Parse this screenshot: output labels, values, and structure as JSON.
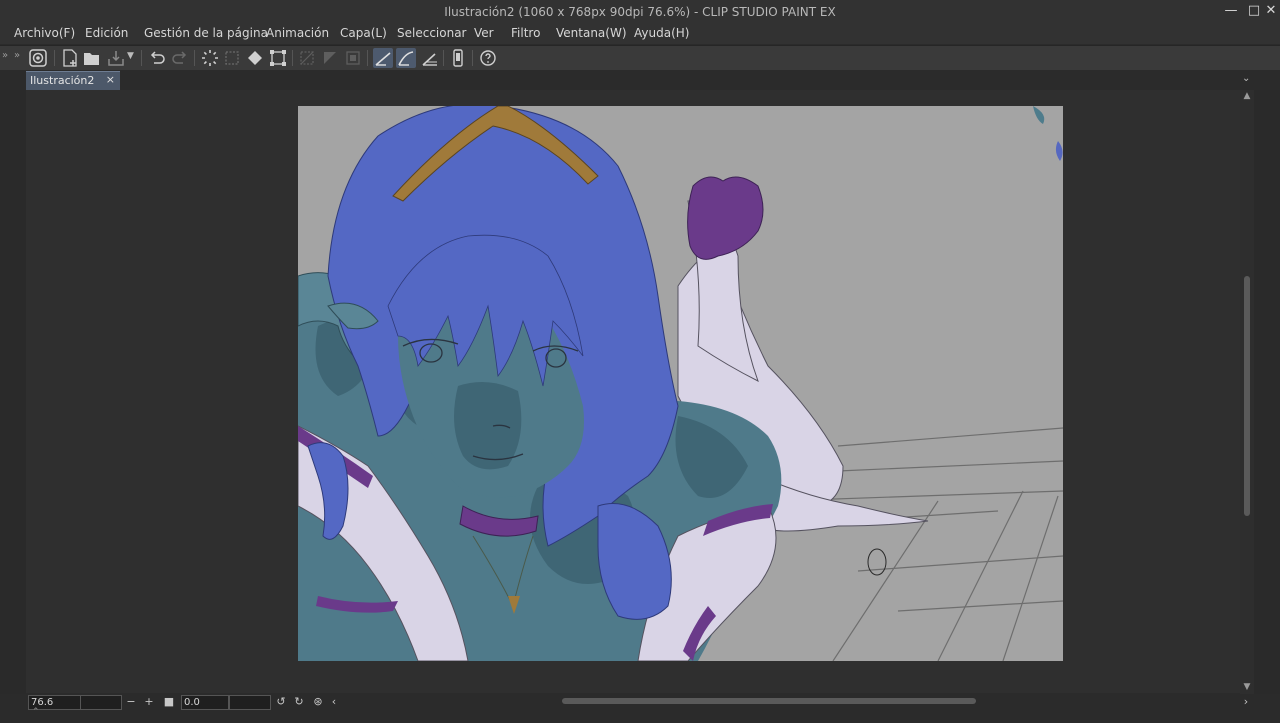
{
  "window": {
    "title": "Ilustración2 (1060 x 768px 90dpi 76.6%)  - CLIP STUDIO PAINT EX",
    "minimize_icon": "minimize-icon",
    "maximize_icon": "maximize-icon",
    "close_icon": "close-icon"
  },
  "menu": {
    "items": [
      "Archivo(F)",
      "Edición",
      "Gestión de la página",
      "Animación",
      "Capa(L)",
      "Seleccionar",
      "Ver",
      "Filtro",
      "Ventana(W)",
      "Ayuda(H)"
    ]
  },
  "toolbar": {
    "icons": [
      "clip-studio-icon",
      "new-file-icon",
      "open-file-icon",
      "save-icon",
      "undo-icon",
      "redo-icon",
      "loading-spinner-icon",
      "clear-icon",
      "fill-icon",
      "transform-icon",
      "deselect-icon",
      "invert-selection-icon",
      "show-selection-icon",
      "snap-ruler-icon",
      "snap-special-ruler-icon",
      "snap-grid-icon",
      "smartphone-icon",
      "help-icon"
    ]
  },
  "tab": {
    "label": "Ilustración2",
    "close": "×"
  },
  "bottombar": {
    "zoom_value": "76.6",
    "angle_value": "0.0",
    "minus": "−",
    "plus": "+"
  },
  "colors": {
    "background": "#2b2b2b",
    "canvas_bg": "#a4a4a4",
    "hair": "#5468c4",
    "skin": "#4f7a8a",
    "glove": "#d9d4e6",
    "ribbon": "#6a3a8a",
    "tiara": "#a07a3a",
    "tab_active": "#4c5869"
  }
}
